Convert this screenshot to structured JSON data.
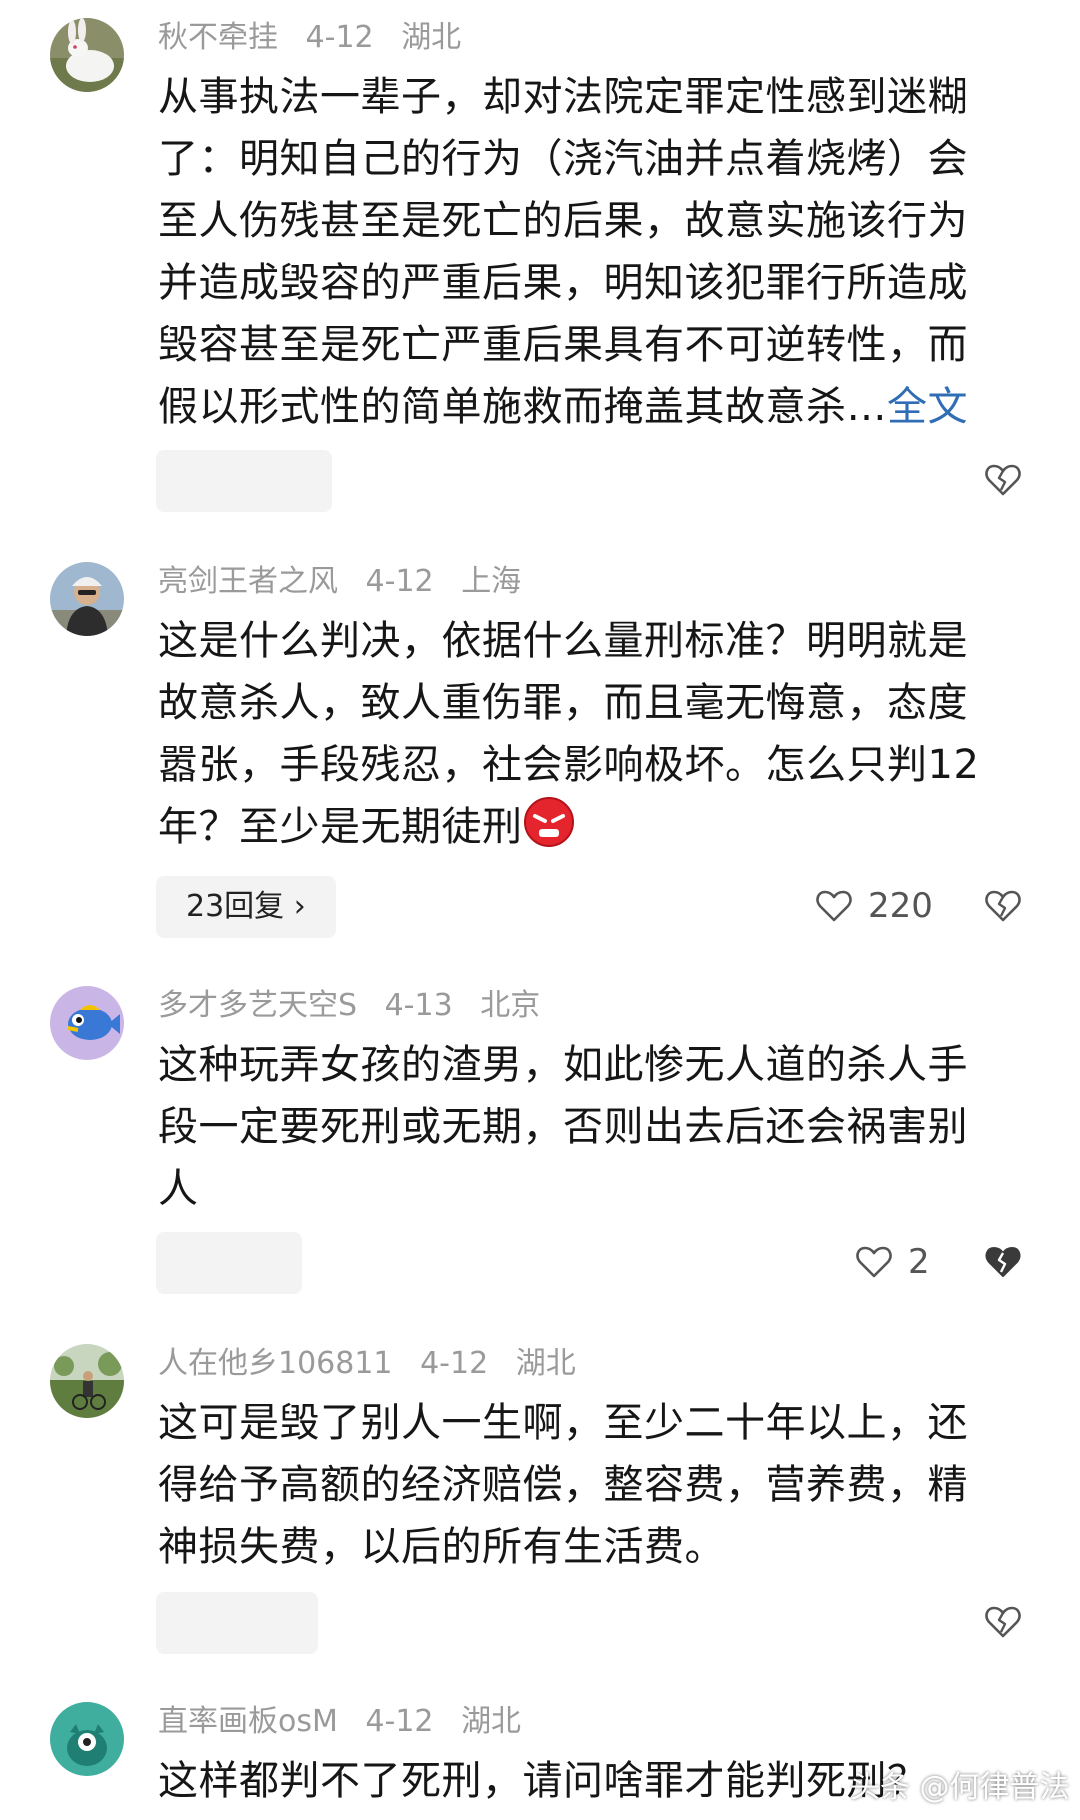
{
  "comments": [
    {
      "user": "秋不牵挂",
      "date": "4-12",
      "location": "湖北",
      "lines": [
        "从事执法一辈子，却对法院定罪定性感到迷糊",
        "了：明知自己的行为（浇汽油并点着烧烤）会",
        "至人伤残甚至是死亡的后果，故意实施该行为",
        "并造成毁容的严重后果，明知该犯罪行所造成",
        "毁容甚至是死亡严重后果具有不可逆转性，而",
        "假以形式性的简单施救而掩盖其故意杀…"
      ],
      "more_label": "全文"
    },
    {
      "user": "亮剑王者之风",
      "date": "4-12",
      "location": "上海",
      "lines": [
        "这是什么判决，依据什么量刑标准？明明就是",
        "故意杀人，致人重伤罪，而且毫无悔意，态度",
        "嚣张，手段残忍，社会影响极坏。怎么只判12",
        "年？至少是无期徒刑"
      ],
      "replies_label": "23回复 ›",
      "likes": "220"
    },
    {
      "user": "多才多艺天空S",
      "date": "4-13",
      "location": "北京",
      "lines": [
        "这种玩弄女孩的渣男，如此惨无人道的杀人手",
        "段一定要死刑或无期，否则出去后还会祸害别",
        "人"
      ],
      "likes": "2"
    },
    {
      "user": "人在他乡106811",
      "date": "4-12",
      "location": "湖北",
      "lines": [
        "这可是毁了别人一生啊，至少二十年以上，还",
        "得给予高额的经济赔偿，整容费，营养费，精",
        "神损失费，以后的所有生活费。"
      ]
    },
    {
      "user": "直率画板osM",
      "date": "4-12",
      "location": "湖北",
      "lines": [
        "这样都判不了死刑，请问啥罪才能判死刑？"
      ]
    }
  ],
  "watermark": "头条 @何律普法",
  "colors": {
    "meta": "#9a9a9a",
    "link": "#2f6db5",
    "chip_bg": "#f3f3f3"
  }
}
